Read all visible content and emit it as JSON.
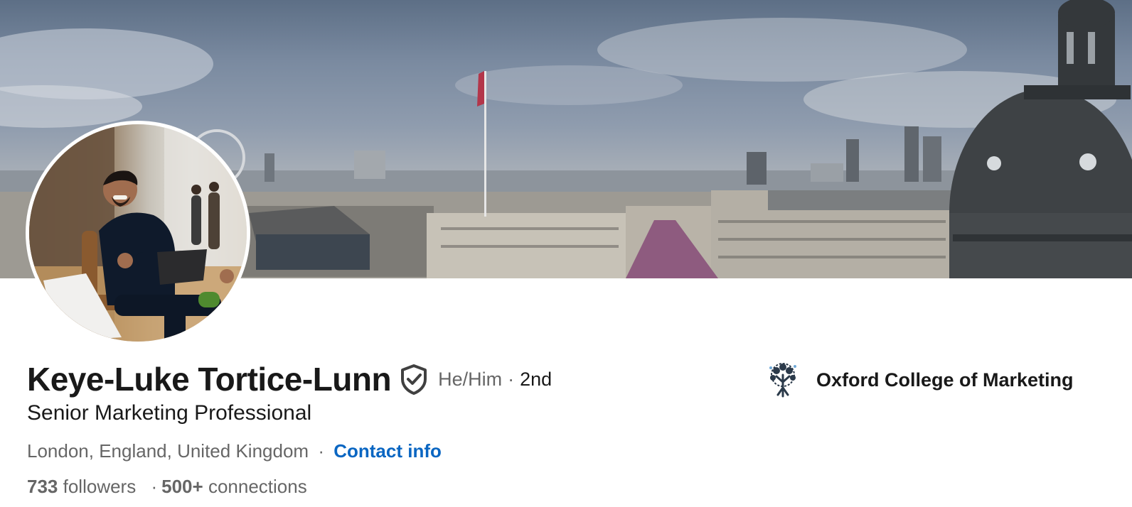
{
  "profile": {
    "name": "Keye-Luke Tortice-Lunn",
    "pronouns": "He/Him",
    "separator": "·",
    "degree": "2nd",
    "headline": "Senior Marketing Professional",
    "location": "London, England, United Kingdom",
    "contact_label": "Contact info",
    "followers_count": "733",
    "followers_label": "followers",
    "connections_count": "500+",
    "connections_label": "connections"
  },
  "organization": {
    "name": "Oxford College of Marketing",
    "logo_icon": "tree-logo-icon"
  },
  "icons": {
    "verification": "shield-check-icon"
  },
  "colors": {
    "link": "#0a66c2",
    "primary_text": "#191919",
    "secondary_text": "#666666"
  }
}
